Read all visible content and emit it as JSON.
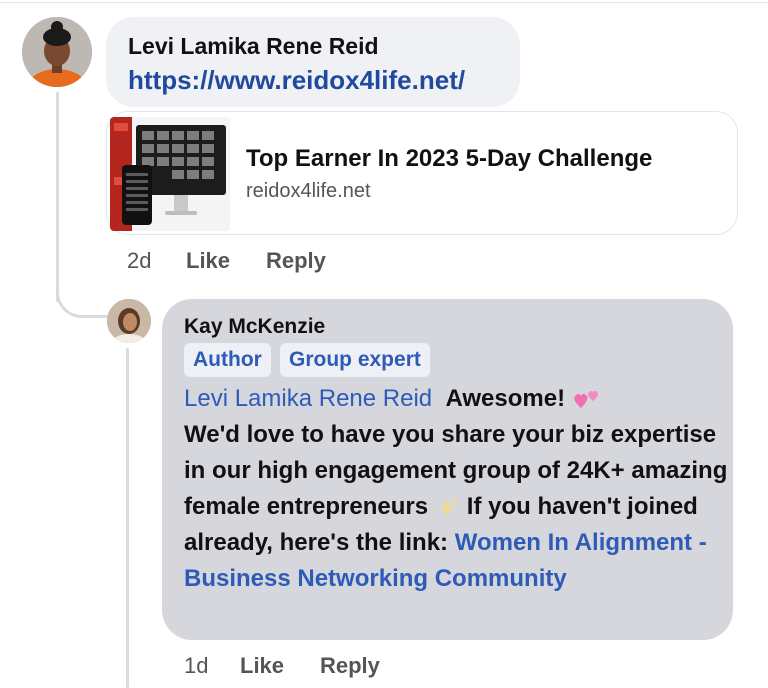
{
  "comment1": {
    "author": "Levi Lamika Rene Reid",
    "link_text": "https://www.reidox4life.net/",
    "preview": {
      "title": "Top Earner In 2023 5-Day Challenge",
      "domain": "reidox4life.net"
    },
    "time": "2d",
    "like_label": "Like",
    "reply_label": "Reply"
  },
  "comment2": {
    "author": "Kay McKenzie",
    "badges": [
      "Author",
      "Group expert"
    ],
    "mention": "Levi Lamika Rene Reid",
    "text_part1": "Awesome!",
    "text_part2": "We'd love to have you share your biz expertise in our high engagement group of 24K+ amazing female entrepreneurs",
    "text_part3": "If you haven't joined already, here's the link:",
    "group_link": "Women In Alignment - Business Networking Community",
    "time": "1d",
    "like_label": "Like",
    "reply_label": "Reply"
  },
  "icons": [
    "profile-photo-icon",
    "two-hearts-emoji-icon",
    "sparkles-emoji-icon"
  ],
  "colors": {
    "link_blue": "#1f4a9e",
    "mention_blue": "#2f5bb8",
    "bubble_light": "#eff1f4",
    "bubble_gray": "#d6d7dc",
    "heart_pink": "#f06fb0"
  }
}
